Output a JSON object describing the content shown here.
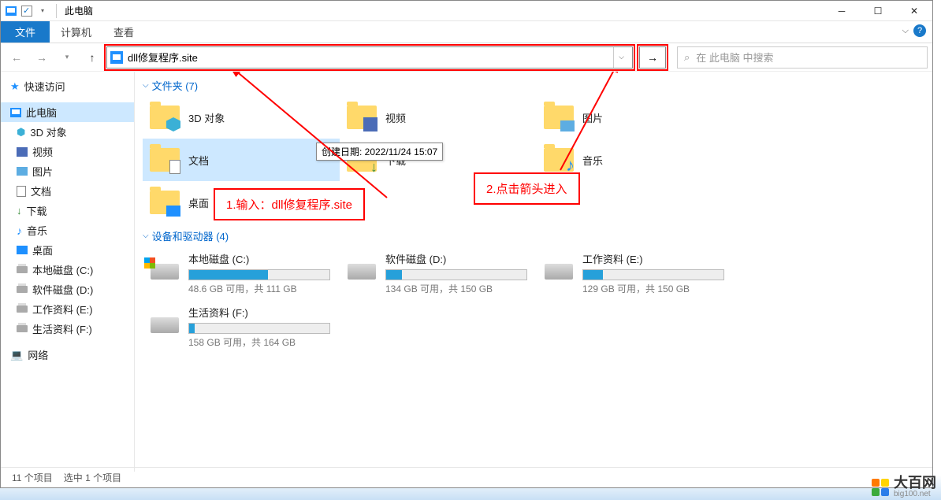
{
  "title": "此电脑",
  "ribbon": {
    "file": "文件",
    "tabs": [
      "计算机",
      "查看"
    ]
  },
  "nav": {
    "address": "dll修复程序.site",
    "search_placeholder": "在 此电脑 中搜索",
    "search_icon": "⌕"
  },
  "sidebar": {
    "quick": "快速访问",
    "thispc": "此电脑",
    "items": [
      "3D 对象",
      "视频",
      "图片",
      "文档",
      "下载",
      "音乐",
      "桌面",
      "本地磁盘 (C:)",
      "软件磁盘 (D:)",
      "工作资料 (E:)",
      "生活资料 (F:)"
    ],
    "network": "网络"
  },
  "sections": {
    "folders": "文件夹 (7)",
    "devices": "设备和驱动器 (4)"
  },
  "folders": [
    "3D 对象",
    "视频",
    "图片",
    "文档",
    "下载",
    "音乐",
    "桌面"
  ],
  "tooltip": "创建日期: 2022/11/24 15:07",
  "drives": [
    {
      "label": "本地磁盘 (C:)",
      "free": "48.6 GB 可用，共 111 GB",
      "pct": 56,
      "os": true
    },
    {
      "label": "软件磁盘 (D:)",
      "free": "134 GB 可用，共 150 GB",
      "pct": 11
    },
    {
      "label": "工作资料 (E:)",
      "free": "129 GB 可用，共 150 GB",
      "pct": 14
    },
    {
      "label": "生活资料 (F:)",
      "free": "158 GB 可用，共 164 GB",
      "pct": 4
    }
  ],
  "annot1": "1.输入：dll修复程序.site",
  "annot2": "2.点击箭头进入",
  "status": {
    "count": "11 个项目",
    "sel": "选中 1 个项目"
  },
  "watermark": {
    "name": "大百网",
    "sub": "big100.net"
  }
}
